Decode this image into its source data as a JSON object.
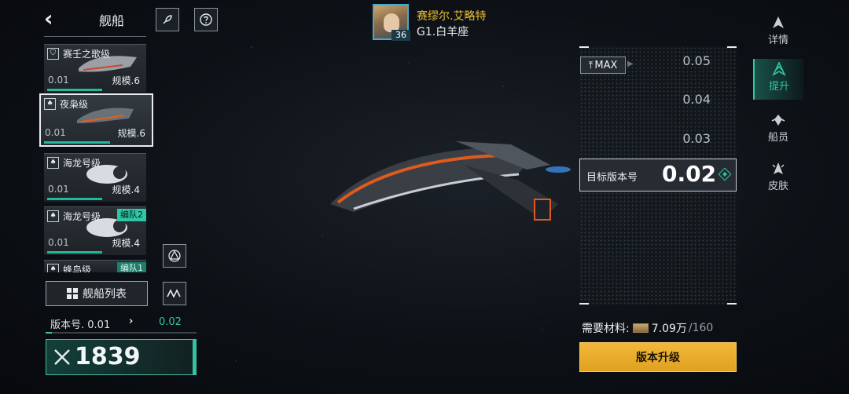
{
  "topbar": {
    "title": "舰船"
  },
  "ships": [
    {
      "class_name": "赛壬之歌级",
      "version": "0.01",
      "scale": "规模.6",
      "selected": false,
      "fleet": ""
    },
    {
      "class_name": "夜枭级",
      "version": "0.01",
      "scale": "规模.6",
      "selected": true,
      "fleet": ""
    },
    {
      "class_name": "海龙号级",
      "version": "0.01",
      "scale": "规模.4",
      "selected": false,
      "fleet": ""
    },
    {
      "class_name": "海龙号级",
      "version": "0.01",
      "scale": "规模.4",
      "selected": false,
      "fleet": "编队2"
    },
    {
      "class_name": "蜂鸟级",
      "version": "",
      "scale": "",
      "selected": false,
      "fleet": "编队1"
    }
  ],
  "ship_list_button": "舰船列表",
  "version_row": {
    "label": "版本号. 0.01",
    "arrow": "›",
    "target": "0.02"
  },
  "power": {
    "value": "1839"
  },
  "captain": {
    "name": "赛缪尔.艾略特",
    "subtitle": "G1.白羊座",
    "level": "36"
  },
  "version_panel": {
    "max_label": "MAX",
    "options": [
      "0.05",
      "0.04",
      "0.03"
    ],
    "target_label": "目标版本号",
    "target_value": "0.02"
  },
  "materials": {
    "label": "需要材料:",
    "have": "7.09万",
    "need": "/160"
  },
  "upgrade_button": "版本升级",
  "right_nav": [
    {
      "label": "详情",
      "active": false
    },
    {
      "label": "提升",
      "active": true
    },
    {
      "label": "船员",
      "active": false
    },
    {
      "label": "皮肤",
      "active": false
    }
  ],
  "colors": {
    "accent": "#2ec6a4",
    "gold": "#f0c030",
    "button_gold": "#f2b83a"
  }
}
